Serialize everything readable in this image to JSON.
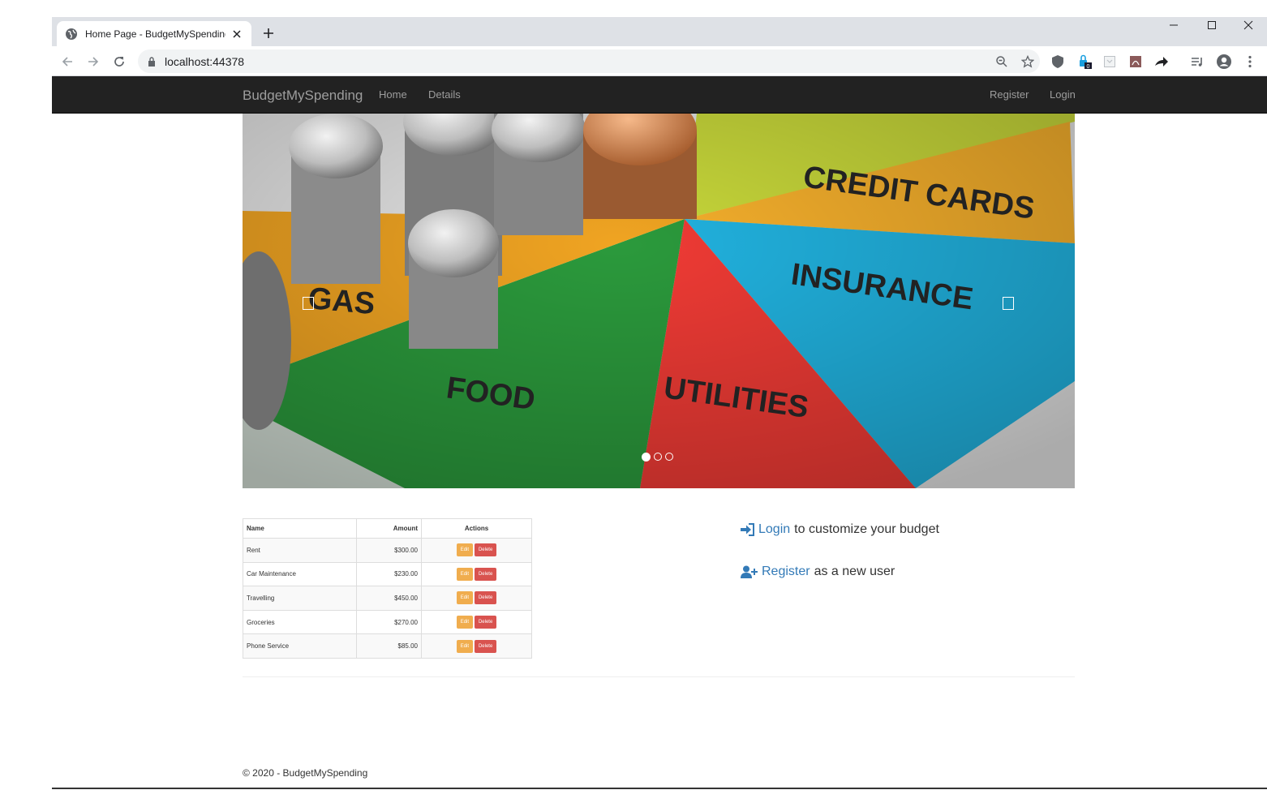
{
  "browser": {
    "tab_title": "Home Page - BudgetMySpending",
    "url": "localhost:44378",
    "extension_badge": "0"
  },
  "navbar": {
    "brand": "BudgetMySpending",
    "links": [
      "Home",
      "Details"
    ],
    "right_links": [
      "Register",
      "Login"
    ]
  },
  "carousel": {
    "labels": [
      "CREDIT CARDS",
      "INSURANCE",
      "GAS",
      "FOOD",
      "UTILITIES"
    ],
    "slides": 3,
    "active_slide": 1
  },
  "table": {
    "headers": [
      "Name",
      "Amount",
      "Actions"
    ],
    "rows": [
      {
        "name": "Rent",
        "amount": "$300.00"
      },
      {
        "name": "Car Maintenance",
        "amount": "$230.00"
      },
      {
        "name": "Travelling",
        "amount": "$450.00"
      },
      {
        "name": "Groceries",
        "amount": "$270.00"
      },
      {
        "name": "Phone Service",
        "amount": "$85.00"
      }
    ],
    "edit_label": "Edit",
    "delete_label": "Delete"
  },
  "prompts": {
    "login_link": "Login",
    "login_text": "to customize your budget",
    "register_link": "Register",
    "register_text": "as a new user"
  },
  "footer": {
    "text": "© 2020 - BudgetMySpending"
  },
  "colors": {
    "navbar": "#222222",
    "link": "#337ab7",
    "edit": "#f0ad4e",
    "delete": "#d9534f"
  }
}
